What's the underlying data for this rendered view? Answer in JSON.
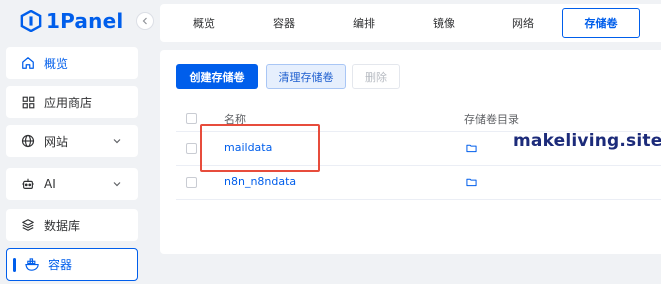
{
  "app": {
    "logo_text": "1Panel",
    "accent": "#005eeb"
  },
  "sidebar": {
    "items": [
      {
        "label": "概览",
        "icon": "home-icon"
      },
      {
        "label": "应用商店",
        "icon": "grid-icon"
      },
      {
        "label": "网站",
        "icon": "globe-icon",
        "has_chevron": true
      },
      {
        "label": "AI",
        "icon": "robot-icon",
        "has_chevron": true
      },
      {
        "label": "数据库",
        "icon": "layers-icon"
      },
      {
        "label": "容器",
        "icon": "whale-icon",
        "active": true
      }
    ]
  },
  "tabs": [
    "概览",
    "容器",
    "编排",
    "镜像",
    "网络",
    "存储卷"
  ],
  "active_tab": "存储卷",
  "toolbar": {
    "create_label": "创建存储卷",
    "prune_label": "清理存储卷",
    "delete_label": "删除"
  },
  "table": {
    "columns": [
      "名称",
      "存储卷目录"
    ],
    "rows": [
      {
        "name": "maildata"
      },
      {
        "name": "n8n_n8ndata"
      }
    ]
  },
  "watermark": "makeliving.site",
  "colors": {
    "highlight": "#e74c3c",
    "watermark": "#1c2b7a"
  }
}
